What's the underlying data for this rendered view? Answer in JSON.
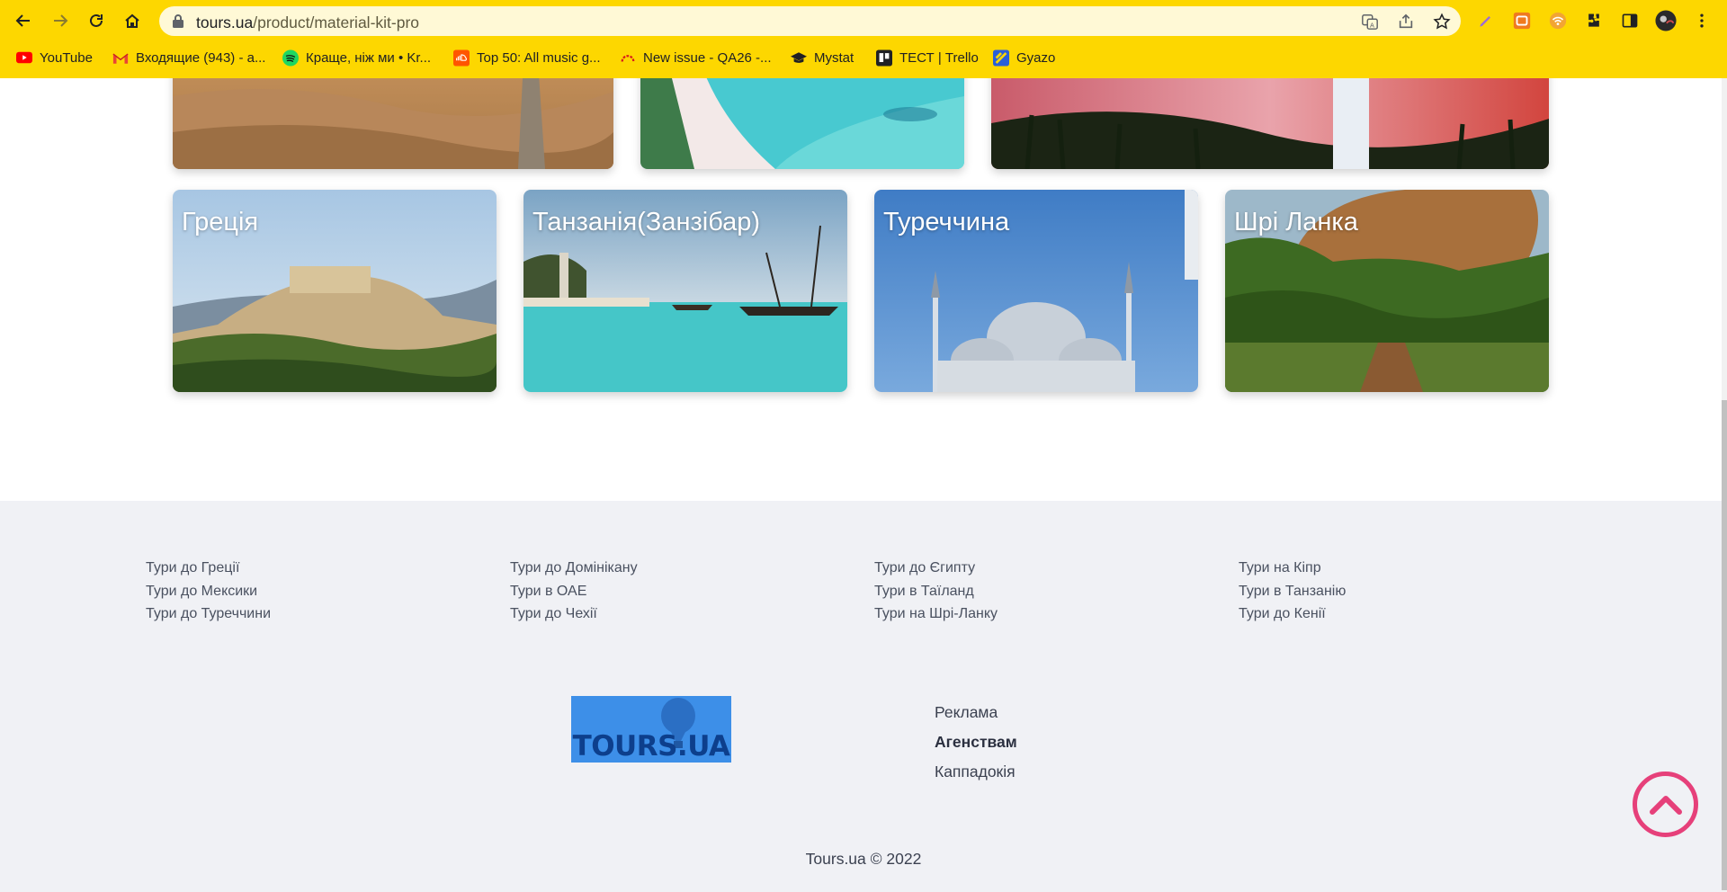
{
  "browser": {
    "url_host": "tours.ua",
    "url_path": "/product/material-kit-pro",
    "bookmarks": [
      {
        "label": "YouTube",
        "icon": "youtube-icon"
      },
      {
        "label": "Входящие (943) - a...",
        "icon": "gmail-icon"
      },
      {
        "label": "Краще, ніж ми • Kr...",
        "icon": "spotify-icon"
      },
      {
        "label": "Top 50: All music g...",
        "icon": "soundcloud-icon"
      },
      {
        "label": "New issue - QA26 -...",
        "icon": "jira-icon"
      },
      {
        "label": "Mystat",
        "icon": "graduation-cap-icon"
      },
      {
        "label": "ТЕСТ | Trello",
        "icon": "trello-icon"
      },
      {
        "label": "Gyazo",
        "icon": "gyazo-icon"
      }
    ]
  },
  "destinations_top": [
    {
      "name": "",
      "scene": "desert"
    },
    {
      "name": "",
      "scene": "beach"
    },
    {
      "name": "",
      "scene": "dubai-sunset"
    }
  ],
  "destinations": [
    {
      "name": "Греція",
      "scene": "acropolis"
    },
    {
      "name": "Танзанія(Занзібар)",
      "scene": "zanzibar"
    },
    {
      "name": "Туреччина",
      "scene": "mosque"
    },
    {
      "name": "Шрі Ланка",
      "scene": "sigiriya"
    }
  ],
  "footer": {
    "columns": [
      [
        "Тури до Греції",
        "Тури до Мексики",
        "Тури до Туреччини"
      ],
      [
        "Тури до Домінікану",
        "Тури в ОАЕ",
        "Тури до Чехії"
      ],
      [
        "Тури до Єгипту",
        "Тури в Таїланд",
        "Тури на Шрі-Ланку"
      ],
      [
        "Тури на Кіпр",
        "Тури в Танзанію",
        "Тури до Кенії"
      ]
    ],
    "logo_text": "TOURS.UA",
    "links": [
      "Реклама",
      "Агенствам",
      "Каппадокія"
    ],
    "copyright": "Tours.ua © 2022"
  },
  "colors": {
    "chrome": "#fdd700",
    "accent": "#e6407a",
    "logo_bg": "#3d8fe8"
  }
}
